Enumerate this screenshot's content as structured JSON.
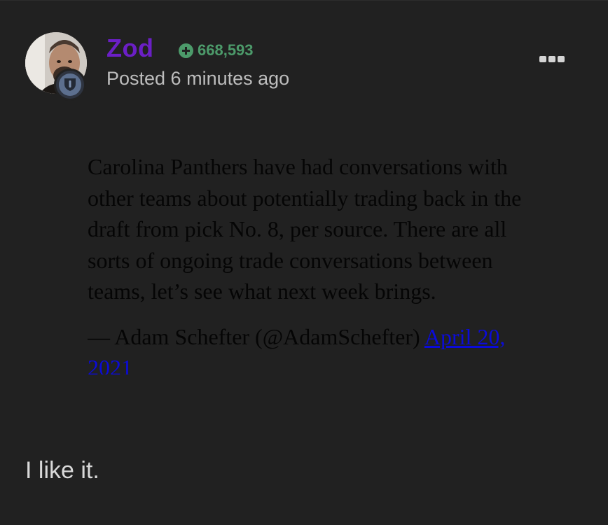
{
  "author": {
    "name": "Zod",
    "reputation": "668,593",
    "posted": "Posted 6 minutes ago"
  },
  "colors": {
    "background": "#212121",
    "author_name": "#6b1fc6",
    "reputation": "#4c9a6a",
    "meta_text": "#bdbdbd",
    "embed_text": "#050505",
    "link": "#0b0bd8"
  },
  "icons": {
    "reputation": "plus-circle-icon",
    "menu": "more-options-icon",
    "badge": "shield-badge-icon"
  },
  "embed": {
    "text": "Carolina Panthers have had conversations with other teams about potentially trading back in the draft from pick No. 8, per source. There are all sorts of ongoing trade conversations between teams, let’s see what next week brings.",
    "attribution": "— Adam Schefter (@AdamSchefter) ",
    "date_link": "April 20, 2021"
  },
  "comment": "I like it."
}
